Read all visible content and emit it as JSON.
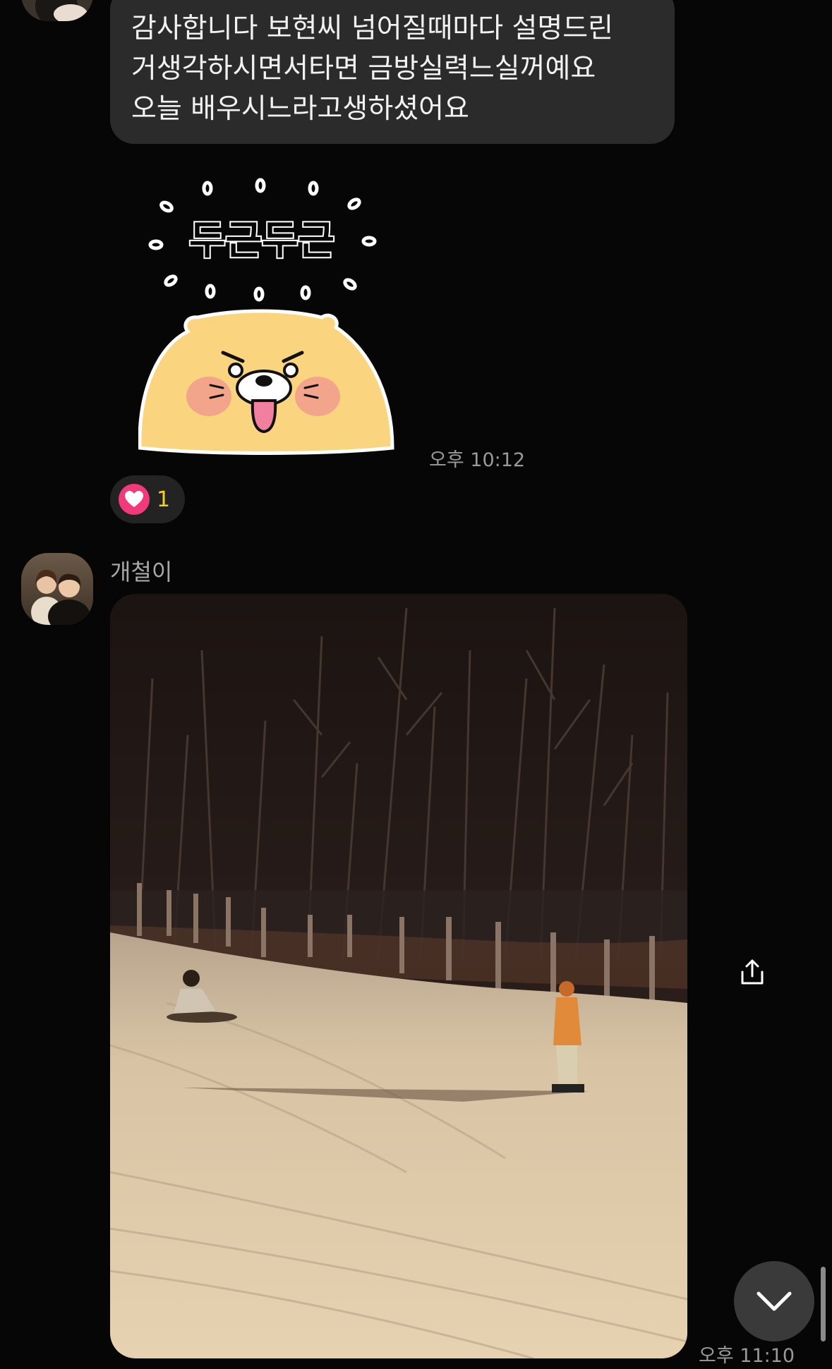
{
  "messages": {
    "top": {
      "lines": [
        "감사합니다 보현씨 넘어질때마다 설명드린",
        "거생각하시면서타면 금방실력느실꺼예요",
        "오늘 배우시느라고생하셨어요"
      ]
    },
    "sticker": {
      "text": "두근두근",
      "time": "오후 10:12",
      "reaction": {
        "icon": "heart-icon",
        "count": "1"
      }
    },
    "photo_message": {
      "sender": "개철이",
      "time": "오후 11:10"
    }
  },
  "controls": {
    "share_icon": "share-icon",
    "scroll_down_icon": "chevron-down-icon"
  },
  "colors": {
    "background": "#060606",
    "bubble": "#2b2b2b",
    "reaction_heart": "#f23a7a",
    "reaction_count": "#f2d21f",
    "sticker_body": "#fbd47f"
  }
}
